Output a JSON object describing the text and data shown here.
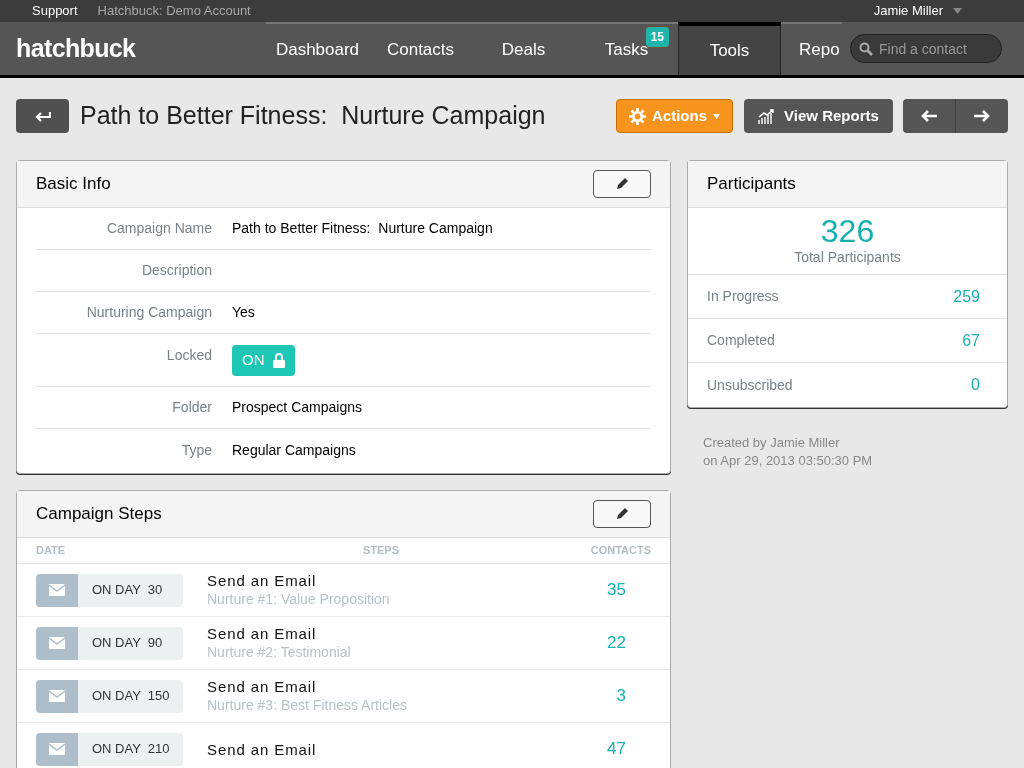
{
  "top_bar": {
    "links": [
      "Support",
      "Hatchbuck: Demo Account"
    ],
    "user": "Jamie Miller"
  },
  "nav": {
    "logo": "hatchbuck",
    "tabs": [
      {
        "label": "Dashboard",
        "selected": false
      },
      {
        "label": "Contacts",
        "selected": false
      },
      {
        "label": "Deals",
        "selected": false
      },
      {
        "label": "Tasks",
        "selected": false,
        "badge": "15"
      },
      {
        "label": "Tools",
        "selected": true
      },
      {
        "label": "Repo",
        "selected": false
      }
    ],
    "search": {
      "placeholder": "Find a contact"
    }
  },
  "page": {
    "title": "Path to Better Fitness:  Nurture Campaign",
    "actions": "Actions",
    "view_reports": "View Reports"
  },
  "basic_info": {
    "title": "Basic Info",
    "fields": [
      {
        "label": "Campaign Name",
        "kind": "text",
        "value": "Path to Better Fitness:  Nurture Campaign"
      },
      {
        "label": "Description",
        "kind": "text"
      },
      {
        "label": "Nurturing Campaign",
        "kind": "text",
        "value": "Yes"
      },
      {
        "label": "Locked",
        "kind": "toggle",
        "value": "ON",
        "on": true
      },
      {
        "label": "Folder",
        "kind": "text",
        "value": "Prospect Campaigns"
      },
      {
        "label": "Type",
        "kind": "text",
        "value": "Regular Campaigns"
      }
    ]
  },
  "campaign_steps": {
    "title": "Campaign Steps",
    "columns": [
      "DATE",
      "STEPS",
      "CONTACTS"
    ],
    "rows": [
      {
        "day": "ON DAY  30",
        "action": "Send an Email",
        "name": "Nurture #1: Value Proposition",
        "contacts": "35"
      },
      {
        "day": "ON DAY  90",
        "action": "Send an Email",
        "name": "Nurture #2: Testimonial",
        "contacts": "22"
      },
      {
        "day": "ON DAY  150",
        "action": "Send an Email",
        "name": "Nurture #3: Best Fitness Articles",
        "contacts": "3"
      },
      {
        "day": "ON DAY  210",
        "action": "Send an Email",
        "contacts": "47"
      }
    ]
  },
  "participants": {
    "title": "Participants",
    "total": "326",
    "total_label": "Total Participants",
    "stats": [
      {
        "label": "In Progress",
        "value": "259"
      },
      {
        "label": "Completed",
        "value": "67"
      },
      {
        "label": "Unsubscribed",
        "value": "0"
      }
    ]
  },
  "created": {
    "by": "Created by Jamie Miller",
    "on": "on Apr 29, 2013 03:50:30 PM"
  }
}
